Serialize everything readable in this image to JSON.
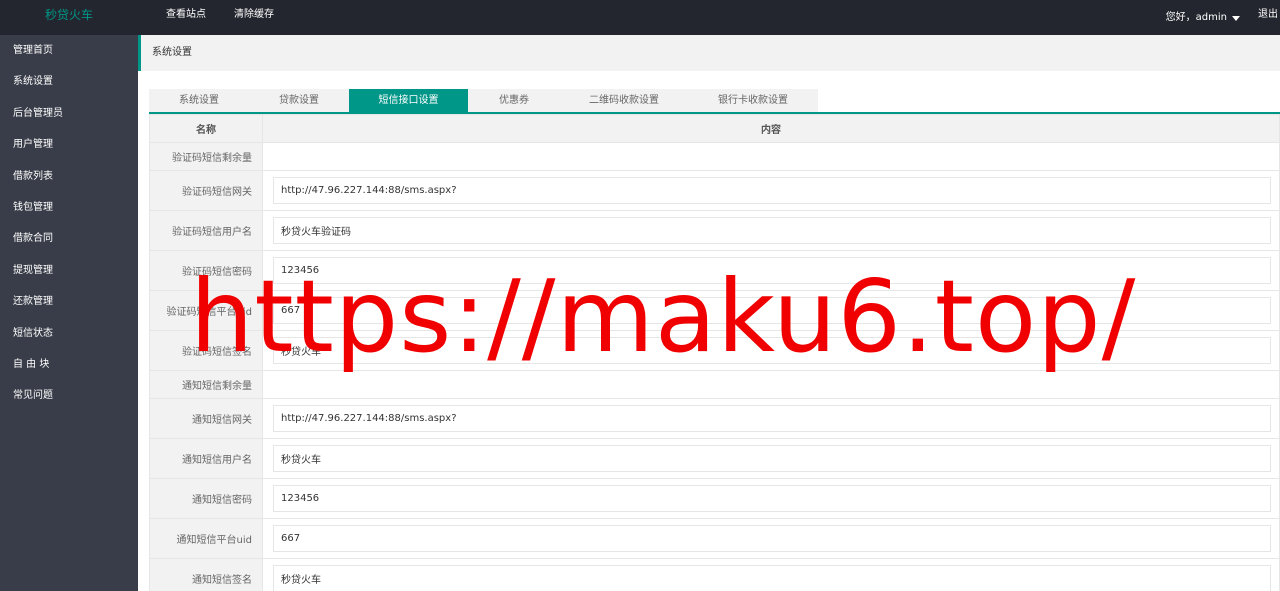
{
  "header": {
    "logo": "秒贷火车",
    "nav": [
      "查看站点",
      "清除缓存"
    ],
    "user_greeting": "您好，admin",
    "logout": "退出"
  },
  "sidebar": {
    "items": [
      "管理首页",
      "系统设置",
      "后台管理员",
      "用户管理",
      "借款列表",
      "钱包管理",
      "借款合同",
      "提现管理",
      "还款管理",
      "短信状态",
      "自 由 块",
      "常见问题"
    ]
  },
  "breadcrumb": "系统设置",
  "tabs": [
    {
      "label": "系统设置",
      "active": false
    },
    {
      "label": "贷款设置",
      "active": false
    },
    {
      "label": "短信接口设置",
      "active": true
    },
    {
      "label": "优惠券",
      "active": false
    },
    {
      "label": "二维码收款设置",
      "active": false
    },
    {
      "label": "银行卡收款设置",
      "active": false
    }
  ],
  "table": {
    "headers": [
      "名称",
      "内容"
    ],
    "rows": [
      {
        "label": "验证码短信剩余量",
        "value": null
      },
      {
        "label": "验证码短信网关",
        "value": "http://47.96.227.144:88/sms.aspx?"
      },
      {
        "label": "验证码短信用户名",
        "value": "秒贷火车验证码"
      },
      {
        "label": "验证码短信密码",
        "value": "123456"
      },
      {
        "label": "验证码短信平台uid",
        "value": "667"
      },
      {
        "label": "验证码短信签名",
        "value": "秒贷火车"
      },
      {
        "label": "通知短信剩余量",
        "value": null
      },
      {
        "label": "通知短信网关",
        "value": "http://47.96.227.144:88/sms.aspx?"
      },
      {
        "label": "通知短信用户名",
        "value": "秒贷火车"
      },
      {
        "label": "通知短信密码",
        "value": "123456"
      },
      {
        "label": "通知短信平台uid",
        "value": "667"
      },
      {
        "label": "通知短信签名",
        "value": "秒贷火车"
      }
    ]
  },
  "watermark": "https://maku6.top/",
  "colors": {
    "accent": "#009688",
    "topbar": "#23262e",
    "sidebar": "#393d49",
    "watermark": "#f00000"
  },
  "icons": {
    "user_menu": "caret-down-icon"
  }
}
